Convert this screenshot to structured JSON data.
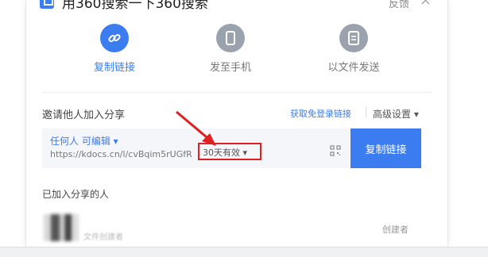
{
  "header": {
    "title": "用360搜索一下360搜索",
    "feedback": "反馈",
    "close": "×"
  },
  "share_options": [
    {
      "label": "复制链接",
      "icon": "link-icon",
      "active": true
    },
    {
      "label": "发至手机",
      "icon": "phone-icon",
      "active": false
    },
    {
      "label": "以文件发送",
      "icon": "file-icon",
      "active": false
    }
  ],
  "invite": {
    "title": "邀请他人加入分享",
    "get_link": "获取免登录链接",
    "advanced": "高级设置 ▾",
    "permission": "任何人 可编辑 ▾",
    "url": "https://kdocs.cn/l/cvBqim5rUGfR",
    "expiry": "30天有效 ▾",
    "copy_button": "复制链接"
  },
  "joined": {
    "title": "已加入分享的人",
    "member_name": "文件创建者",
    "member_role": "创建者"
  },
  "colors": {
    "accent": "#3b7df0",
    "highlight": "#e02020"
  }
}
